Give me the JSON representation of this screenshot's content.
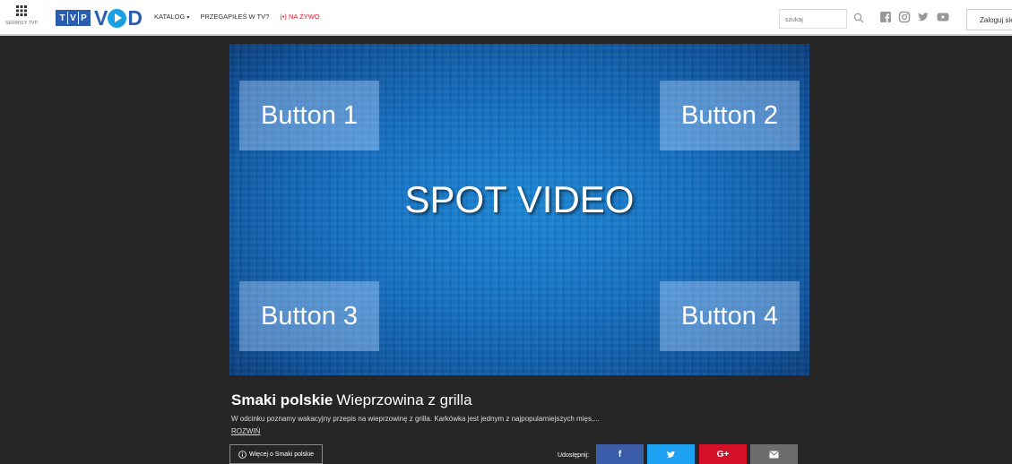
{
  "header": {
    "services_label": "SERWISY TVP",
    "logo": {
      "tvp_letters": [
        "T",
        "V",
        "P"
      ],
      "vod_left": "V",
      "vod_right": "D"
    },
    "nav": [
      {
        "label": "KATALOG",
        "caret": "▾"
      },
      {
        "label": "PRZEGAPIŁEŚ W TV?"
      },
      {
        "label": "(•) NA ŻYWO"
      }
    ],
    "search_placeholder": "szukaj",
    "social_icons": [
      "facebook-icon",
      "instagram-icon",
      "twitter-icon",
      "youtube-icon"
    ],
    "login_label": "Zaloguj się"
  },
  "player": {
    "buttons": [
      "Button 1",
      "Button 2",
      "Button 3",
      "Button 4"
    ],
    "center_text": "SPOT VIDEO"
  },
  "program": {
    "series": "Smaki polskie",
    "episode": "Wieprzowina z grilla",
    "description": "W odcinku poznamy wakacyjny przepis na wieprzowinę z grilla. Karkówka jest jednym z najpopularniejszych mięs,...",
    "expand_label": "ROZWIŃ",
    "more_label": "Więcej o Smaki polskie"
  },
  "share": {
    "label": "Udostępnij:",
    "buttons": [
      {
        "name": "facebook",
        "text": "f",
        "color": "#3b5ca8"
      },
      {
        "name": "twitter",
        "text": "🐦",
        "color": "#1da1f2"
      },
      {
        "name": "google-plus",
        "text": "G+",
        "color": "#d50f25"
      },
      {
        "name": "email",
        "text": "✉",
        "color": "#6d6d6d"
      }
    ]
  },
  "colors": {
    "page_bg": "#262626",
    "brand_blue": "#2a5db0",
    "live_red": "#d8132b"
  }
}
